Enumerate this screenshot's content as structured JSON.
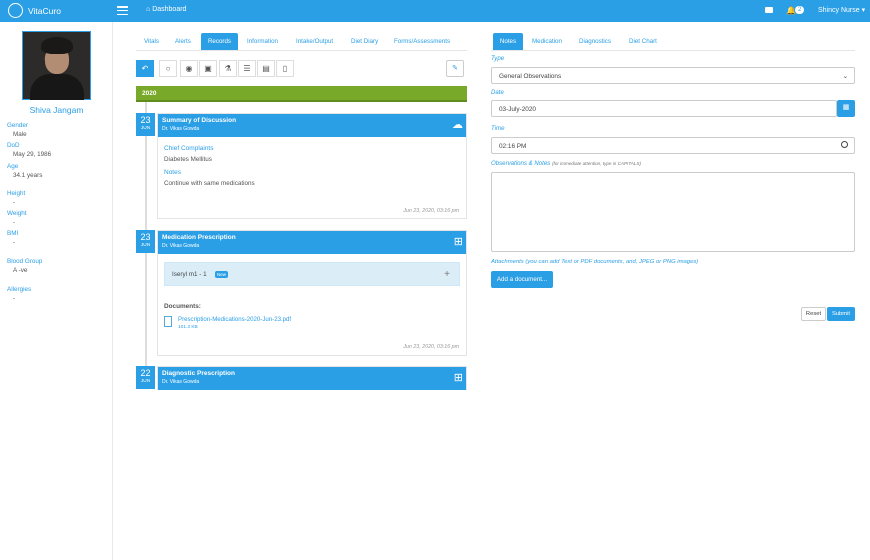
{
  "app": {
    "name": "VitaCuro",
    "breadcrumb": "Dashboard",
    "notification_count": "2",
    "user_name": "Shincy Nurse"
  },
  "patient": {
    "name": "Shiva Jangam",
    "fields": [
      {
        "label": "Gender",
        "value": "Male"
      },
      {
        "label": "DoD",
        "value": "May 29, 1986"
      },
      {
        "label": "Age",
        "value": "34.1 years"
      },
      {
        "label": "Height",
        "value": "-"
      },
      {
        "label": "Weight",
        "value": "-"
      },
      {
        "label": "BMI",
        "value": "-"
      },
      {
        "label": "Blood Group",
        "value": "A -ve"
      },
      {
        "label": "Allergies",
        "value": "-"
      }
    ]
  },
  "record_tabs": [
    "Vitals",
    "Alerts",
    "Records",
    "Information",
    "Intake/Output",
    "Diet Diary",
    "Forms/Assessments"
  ],
  "record_active_tab": "Records",
  "toolbar_icons": [
    "reply-icon",
    "chat-icon",
    "user-circle-icon",
    "medical-kit-icon",
    "flask-icon",
    "list-icon",
    "save-icon",
    "document-icon"
  ],
  "timeline": {
    "year": "2020",
    "entries": [
      {
        "day": "23",
        "month": "JUN",
        "title": "Summary of Discussion",
        "doctor": "Dr. Vikas Gowda",
        "sections": [
          {
            "heading": "Chief Complaints",
            "text": "Diabetes Mellitus"
          },
          {
            "heading": "Notes",
            "text": "Continue with same medications"
          }
        ],
        "timestamp": "Jun 23, 2020, 03:16 pm"
      },
      {
        "day": "23",
        "month": "JUN",
        "title": "Medication Prescription",
        "doctor": "Dr. Vikas Gowda",
        "medication": {
          "name": "Iseryl m1",
          "dose": "- 1",
          "badge": "New"
        },
        "documents_label": "Documents:",
        "document_name": "Prescription-Medications-2020-Jun-23.pdf",
        "document_size": "101.3 KB",
        "timestamp": "Jun 23, 2020, 03:16 pm"
      },
      {
        "day": "22",
        "month": "JUN",
        "title": "Diagnostic Prescription",
        "doctor": "Dr. Vikas Gowda"
      }
    ]
  },
  "notes_tabs": [
    "Notes",
    "Medication",
    "Diagnostics",
    "Diet Chart"
  ],
  "notes_active_tab": "Notes",
  "form": {
    "type_label": "Type",
    "type_value": "General Observations",
    "date_label": "Date",
    "date_value": "03-July-2020",
    "time_label": "Time",
    "time_value": "02:16 PM",
    "notes_label": "Observations & Notes",
    "notes_hint": "(for immediate attention, type in CAPITALS)",
    "attachments_note": "Attachments (you can add Text or PDF documents, and, JPEG or PNG images)",
    "add_document_label": "Add a document...",
    "reset_label": "Reset",
    "submit_label": "Submit"
  },
  "colors": {
    "primary": "#2b9fe6",
    "year_bar": "#79a929"
  }
}
